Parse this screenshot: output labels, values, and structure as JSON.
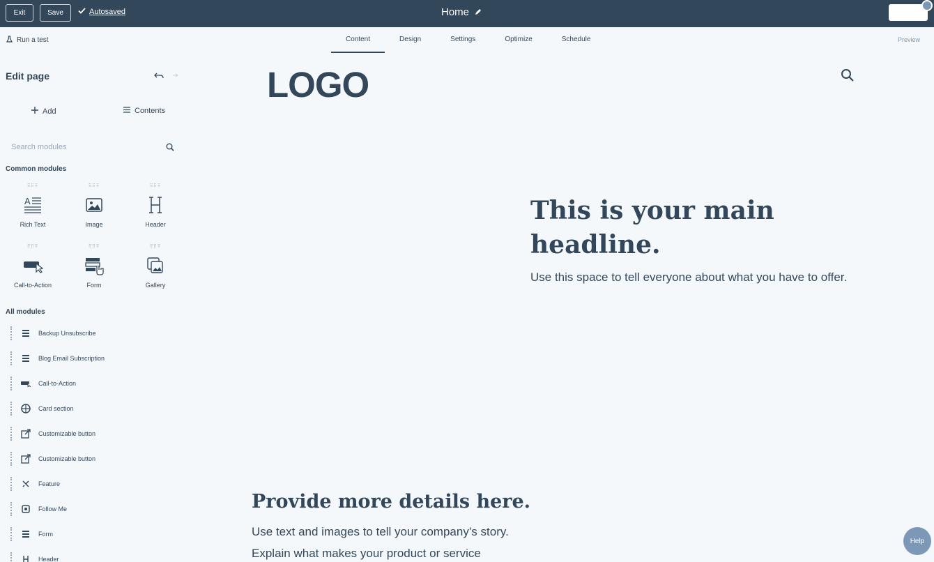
{
  "topbar": {
    "exit_label": "Exit",
    "save_label": "Save",
    "autosaved_label": "Autosaved",
    "page_title": "Home"
  },
  "subbar": {
    "run_test_label": "Run a test",
    "tabs": [
      "Content",
      "Design",
      "Settings",
      "Optimize",
      "Schedule"
    ],
    "active_tab": "Content",
    "preview_label": "Preview"
  },
  "sidebar": {
    "title": "Edit page",
    "add_label": "Add",
    "contents_label": "Contents",
    "search_placeholder": "Search modules",
    "common_label": "Common modules",
    "common_modules": [
      "Rich Text",
      "Image",
      "Header",
      "Call-to-Action",
      "Form",
      "Gallery"
    ],
    "all_label": "All modules",
    "all_modules": [
      {
        "name": "Backup Unsubscribe",
        "icon": "form-icon"
      },
      {
        "name": "Blog Email Subscription",
        "icon": "form-icon"
      },
      {
        "name": "Call-to-Action",
        "icon": "cta-icon"
      },
      {
        "name": "Card section",
        "icon": "card-icon"
      },
      {
        "name": "Customizable button",
        "icon": "external-link-icon"
      },
      {
        "name": "Customizable button",
        "icon": "external-link-icon"
      },
      {
        "name": "Feature",
        "icon": "feature-icon"
      },
      {
        "name": "Follow Me",
        "icon": "follow-icon"
      },
      {
        "name": "Form",
        "icon": "form-icon"
      },
      {
        "name": "Header",
        "icon": "header-icon"
      }
    ]
  },
  "canvas": {
    "logo": "LOGO",
    "headline": "This is your main headline.",
    "subheadline": "Use this space to tell everyone about what you have to offer.",
    "details_title": "Provide more details here.",
    "details_p1": "Use text and images to tell your company’s story.",
    "details_p2": "Explain what makes your product or service"
  },
  "help_label": "Help",
  "colors": {
    "topbar": "#33475b",
    "text": "#33475b",
    "background": "#f5f8fa"
  }
}
